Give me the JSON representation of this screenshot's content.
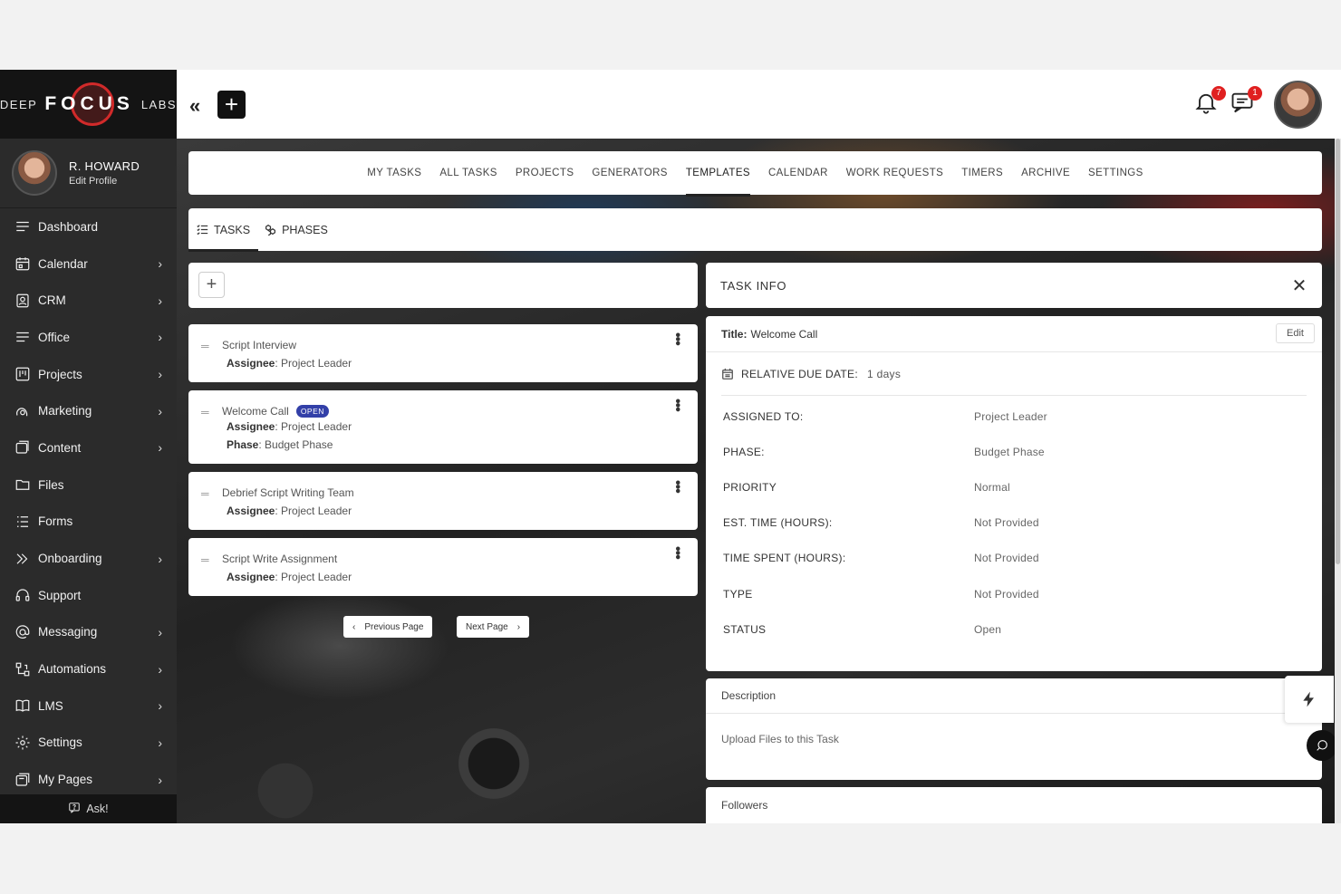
{
  "brand": {
    "deep": "DEEP",
    "focus": "FOCUS",
    "labs": "LABS",
    "ring_color": "#d12a2a"
  },
  "profile": {
    "name": "R. HOWARD",
    "edit_label": "Edit Profile"
  },
  "sidebar": {
    "items": [
      {
        "label": "Dashboard",
        "icon": "menu-icon",
        "has_submenu": false
      },
      {
        "label": "Calendar",
        "icon": "calendar-icon",
        "has_submenu": true
      },
      {
        "label": "CRM",
        "icon": "contact-icon",
        "has_submenu": true
      },
      {
        "label": "Office",
        "icon": "menu-icon",
        "has_submenu": true
      },
      {
        "label": "Projects",
        "icon": "kanban-icon",
        "has_submenu": true
      },
      {
        "label": "Marketing",
        "icon": "megaphone-icon",
        "has_submenu": true
      },
      {
        "label": "Content",
        "icon": "content-icon",
        "has_submenu": true
      },
      {
        "label": "Files",
        "icon": "folder-icon",
        "has_submenu": false
      },
      {
        "label": "Forms",
        "icon": "list-icon",
        "has_submenu": false
      },
      {
        "label": "Onboarding",
        "icon": "double-chevron-icon",
        "has_submenu": true
      },
      {
        "label": "Support",
        "icon": "headset-icon",
        "has_submenu": false
      },
      {
        "label": "Messaging",
        "icon": "at-icon",
        "has_submenu": true
      },
      {
        "label": "Automations",
        "icon": "flow-icon",
        "has_submenu": true
      },
      {
        "label": "LMS",
        "icon": "book-icon",
        "has_submenu": true
      },
      {
        "label": "Settings",
        "icon": "gear-icon",
        "has_submenu": true
      },
      {
        "label": "My Pages",
        "icon": "pages-icon",
        "has_submenu": true
      }
    ],
    "ask_label": "Ask!"
  },
  "topbar": {
    "notifications_count": "7",
    "messages_count": "1"
  },
  "tabs": [
    {
      "label": "MY TASKS",
      "active": false
    },
    {
      "label": "ALL TASKS",
      "active": false
    },
    {
      "label": "PROJECTS",
      "active": false
    },
    {
      "label": "GENERATORS",
      "active": false
    },
    {
      "label": "TEMPLATES",
      "active": true
    },
    {
      "label": "CALENDAR",
      "active": false
    },
    {
      "label": "WORK REQUESTS",
      "active": false
    },
    {
      "label": "TIMERS",
      "active": false
    },
    {
      "label": "ARCHIVE",
      "active": false
    },
    {
      "label": "SETTINGS",
      "active": false
    }
  ],
  "subtabs": {
    "tasks": "TASKS",
    "phases": "PHASES"
  },
  "tasks": [
    {
      "title": "Script Interview",
      "assignee_label": "Assignee",
      "assignee": ": Project Leader"
    },
    {
      "title": "Welcome Call",
      "status": "OPEN",
      "assignee_label": "Assignee",
      "assignee": ": Project Leader",
      "phase_label": "Phase",
      "phase": ": Budget Phase"
    },
    {
      "title": "Debrief Script Writing Team",
      "assignee_label": "Assignee",
      "assignee": ": Project Leader"
    },
    {
      "title": "Script Write Assignment",
      "assignee_label": "Assignee",
      "assignee": ": Project Leader"
    }
  ],
  "pager": {
    "prev": "Previous Page",
    "next": "Next Page"
  },
  "task_info": {
    "heading": "TASK INFO",
    "title_label": "Title:",
    "title_value": "Welcome Call",
    "edit_label": "Edit",
    "due_label": "RELATIVE DUE DATE:",
    "due_value": "1 days",
    "rows": [
      {
        "key": "ASSIGNED TO:",
        "value": "Project Leader"
      },
      {
        "key": "PHASE:",
        "value": "Budget Phase"
      },
      {
        "key": "PRIORITY",
        "value": "Normal"
      },
      {
        "key": "EST. TIME (HOURS):",
        "value": "Not Provided"
      },
      {
        "key": "TIME SPENT (HOURS):",
        "value": "Not Provided"
      },
      {
        "key": "TYPE",
        "value": "Not Provided"
      },
      {
        "key": "STATUS",
        "value": "Open"
      }
    ]
  },
  "description": {
    "heading": "Description",
    "body": "Upload Files to this Task"
  },
  "followers": {
    "heading": "Followers"
  }
}
